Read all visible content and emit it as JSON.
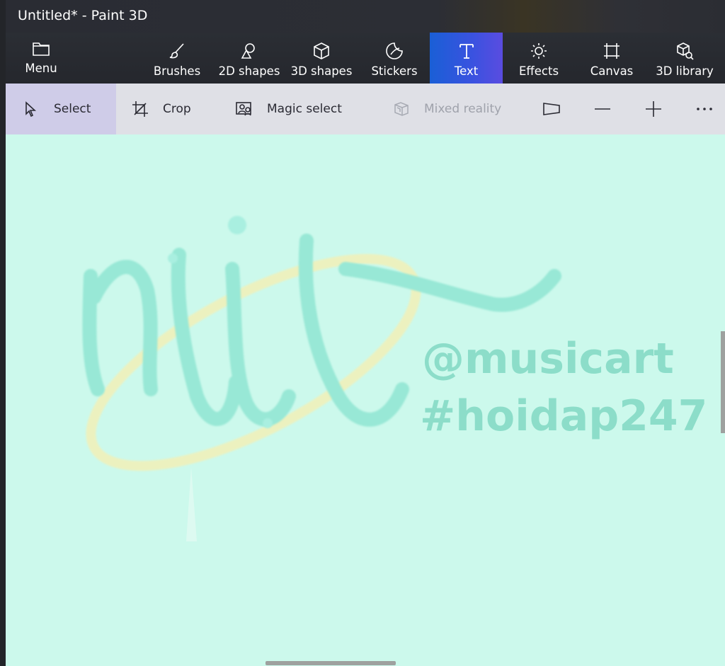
{
  "window": {
    "title": "Untitled* - Paint 3D"
  },
  "toolbar": {
    "menu_label": "Menu",
    "tools": [
      {
        "label": "Brushes",
        "icon": "brush-icon"
      },
      {
        "label": "2D shapes",
        "icon": "2d-shapes-icon"
      },
      {
        "label": "3D shapes",
        "icon": "3d-shapes-icon"
      },
      {
        "label": "Stickers",
        "icon": "stickers-icon"
      },
      {
        "label": "Text",
        "icon": "text-icon",
        "active": true
      },
      {
        "label": "Effects",
        "icon": "effects-icon"
      },
      {
        "label": "Canvas",
        "icon": "canvas-icon"
      },
      {
        "label": "3D library",
        "icon": "3d-library-icon"
      }
    ],
    "active_color": "#3b52e0"
  },
  "subbar": {
    "select_label": "Select",
    "crop_label": "Crop",
    "magic_select_label": "Magic select",
    "mixed_reality_label": "Mixed reality",
    "selected_color": "#cfcce8"
  },
  "canvas": {
    "background_color": "#ccf9ec",
    "watermark_lines": [
      "@musicart",
      "#hoidap247"
    ]
  }
}
